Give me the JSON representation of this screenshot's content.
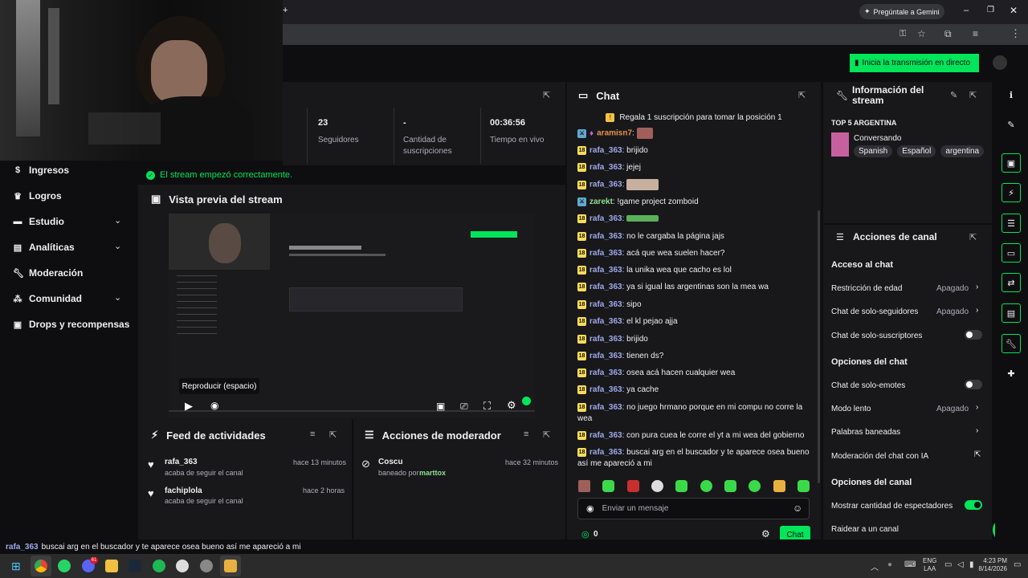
{
  "browser": {
    "gemini_label": "Pregúntale a Gemini"
  },
  "dashboard": {
    "go_live_label": "Inicia la transmisión en directo"
  },
  "sidebar": {
    "items": [
      {
        "label": "Ingresos",
        "icon": "dollar-icon",
        "chevron": false
      },
      {
        "label": "Logros",
        "icon": "trophy-icon",
        "chevron": false
      },
      {
        "label": "Estudio",
        "icon": "studio-icon",
        "chevron": true
      },
      {
        "label": "Analíticas",
        "icon": "chart-icon",
        "chevron": true
      },
      {
        "label": "Moderación",
        "icon": "wrench-icon",
        "chevron": false
      },
      {
        "label": "Comunidad",
        "icon": "people-icon",
        "chevron": true
      },
      {
        "label": "Drops y recompensas",
        "icon": "gift-icon",
        "chevron": false
      }
    ]
  },
  "stats": {
    "followers_value": "23",
    "followers_label": "Seguidores",
    "subs_value": "-",
    "subs_label": "Cantidad de suscripciones",
    "live_value": "00:36:56",
    "live_label": "Tiempo en vivo"
  },
  "notice": {
    "text": "El stream empezó correctamente."
  },
  "preview": {
    "title": "Vista previa del stream",
    "tooltip": "Reproducir (espacio)"
  },
  "feed": {
    "title": "Feed de actividades",
    "items": [
      {
        "user": "rafa_363",
        "time": "hace 13 minutos",
        "action": "acaba de seguir el canal"
      },
      {
        "user": "fachiplola",
        "time": "hace 2 horas",
        "action": "acaba de seguir el canal"
      }
    ]
  },
  "mod_actions": {
    "title": "Acciones de moderador",
    "items": [
      {
        "user": "Coscu",
        "time": "hace 32 minutos",
        "action_prefix": "baneado por",
        "moderator": "marttox"
      }
    ]
  },
  "chat": {
    "title": "Chat",
    "banner": "Regala 1 suscripción para tomar la posición 1",
    "messages": [
      {
        "badge": "mod",
        "user": "aramisn7",
        "text": "",
        "emote": true
      },
      {
        "badge": "18",
        "user": "rafa_363",
        "text": "brijido"
      },
      {
        "badge": "18",
        "user": "rafa_363",
        "text": "jejej"
      },
      {
        "badge": "18",
        "user": "rafa_363",
        "text": "",
        "emote": true
      },
      {
        "badge": "mod",
        "user": "zarekt",
        "text": "!game project zomboid"
      },
      {
        "badge": "18",
        "user": "rafa_363",
        "text": "",
        "emote": true
      },
      {
        "badge": "18",
        "user": "rafa_363",
        "text": "no le cargaba la página jajs"
      },
      {
        "badge": "18",
        "user": "rafa_363",
        "text": "acá que wea suelen hacer?"
      },
      {
        "badge": "18",
        "user": "rafa_363",
        "text": "la unika wea que cacho es lol"
      },
      {
        "badge": "18",
        "user": "rafa_363",
        "text": "ya si igual las argentinas son la mea wa"
      },
      {
        "badge": "18",
        "user": "rafa_363",
        "text": "sipo"
      },
      {
        "badge": "18",
        "user": "rafa_363",
        "text": "el kl pejao ajja"
      },
      {
        "badge": "18",
        "user": "rafa_363",
        "text": "brijido"
      },
      {
        "badge": "18",
        "user": "rafa_363",
        "text": "tienen ds?"
      },
      {
        "badge": "18",
        "user": "rafa_363",
        "text": "osea acá hacen cualquier wea"
      },
      {
        "badge": "18",
        "user": "rafa_363",
        "text": "ya cache"
      },
      {
        "badge": "18",
        "user": "rafa_363",
        "text": "no juego hrmano porque en mi compu no corre la wea"
      },
      {
        "badge": "18",
        "user": "rafa_363",
        "text": "con pura cuea le corre el yt a mi wea del gobierno"
      },
      {
        "badge": "18",
        "user": "rafa_363",
        "text": "buscai arg en el buscador y te aparece osea bueno así me apareció a mi"
      }
    ],
    "input_placeholder": "Enviar un mensaje",
    "points": "0",
    "send_label": "Chat"
  },
  "stream_info": {
    "title": "Información del stream",
    "stream_title": "TOP 5 ARGENTINA",
    "category": "Conversando",
    "tags": [
      "Spanish",
      "Español",
      "argentina"
    ]
  },
  "channel_actions": {
    "title": "Acciones de canal",
    "chat_access": "Acceso al chat",
    "age_restriction": "Restricción de edad",
    "age_value": "Apagado",
    "followers_only": "Chat de solo-seguidores",
    "followers_value": "Apagado",
    "subs_only": "Chat de solo-suscriptores",
    "chat_options": "Opciones del chat",
    "emotes_only": "Chat de solo-emotes",
    "slow_mode": "Modo lento",
    "slow_value": "Apagado",
    "banned_words": "Palabras baneadas",
    "ai_moderation": "Moderación del chat con IA",
    "channel_options": "Opciones del canal",
    "show_viewers": "Mostrar cantidad de espectadores",
    "raid": "Raidear a un canal"
  },
  "caption": {
    "user": "rafa_363",
    "text": "buscai arg en el buscador y te aparece osea bueno así me apareció a mi"
  },
  "taskbar": {
    "lang": "ENG",
    "region": "LAA",
    "time": "4:23 PM",
    "date": "8/14/2026",
    "discord_badge": "61"
  },
  "colors": {
    "accent": "#00e55a",
    "panel": "#18181b",
    "background": "#0e0e10"
  }
}
